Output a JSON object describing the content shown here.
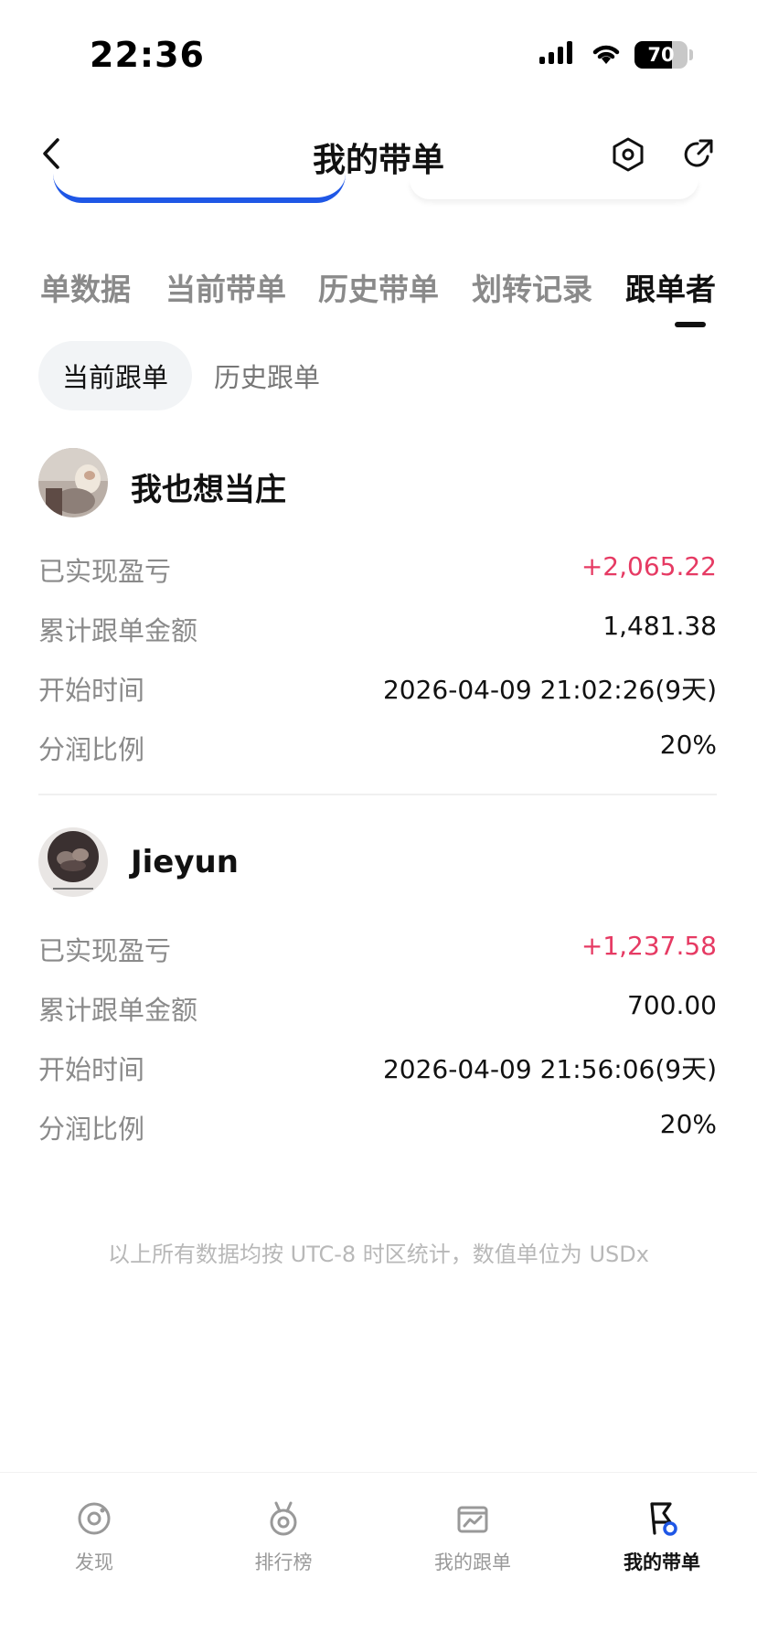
{
  "status_bar": {
    "time": "22:36",
    "battery": "70",
    "battery_level": 0.7
  },
  "header": {
    "title": "我的带单",
    "back_icon": "chevron-left-icon",
    "settings_icon": "hexagon-gear-icon",
    "share_icon": "share-arrow-icon"
  },
  "main_tabs": [
    {
      "label": "单数据",
      "active": false
    },
    {
      "label": "当前带单",
      "active": false
    },
    {
      "label": "历史带单",
      "active": false
    },
    {
      "label": "划转记录",
      "active": false
    },
    {
      "label": "跟单者",
      "active": true
    }
  ],
  "sub_tabs": [
    {
      "label": "当前跟单",
      "active": true
    },
    {
      "label": "历史跟单",
      "active": false
    }
  ],
  "labels": {
    "realized_pnl": "已实现盈亏",
    "total_copy_amount": "累计跟单金额",
    "start_time": "开始时间",
    "profit_share": "分润比例"
  },
  "followers": [
    {
      "name": "我也想当庄",
      "realized_pnl": "+2,065.22",
      "total_copy_amount": "1,481.38",
      "start_time": "2026-04-09 21:02:26(9天)",
      "profit_share": "20%"
    },
    {
      "name": "Jieyun",
      "realized_pnl": "+1,237.58",
      "total_copy_amount": "700.00",
      "start_time": "2026-04-09 21:56:06(9天)",
      "profit_share": "20%"
    }
  ],
  "footnote": "以上所有数据均按 UTC-8 时区统计，数值单位为 USDx",
  "colors": {
    "accent": "#1f57e6",
    "profit": "#e63a63",
    "text_primary": "#111111",
    "text_secondary": "#8a8a8a"
  },
  "bottom_nav": [
    {
      "label": "发现",
      "icon": "discover-icon",
      "active": false
    },
    {
      "label": "排行榜",
      "icon": "medal-icon",
      "active": false
    },
    {
      "label": "我的跟单",
      "icon": "chart-board-icon",
      "active": false
    },
    {
      "label": "我的带单",
      "icon": "flag-lead-icon",
      "active": true
    }
  ]
}
